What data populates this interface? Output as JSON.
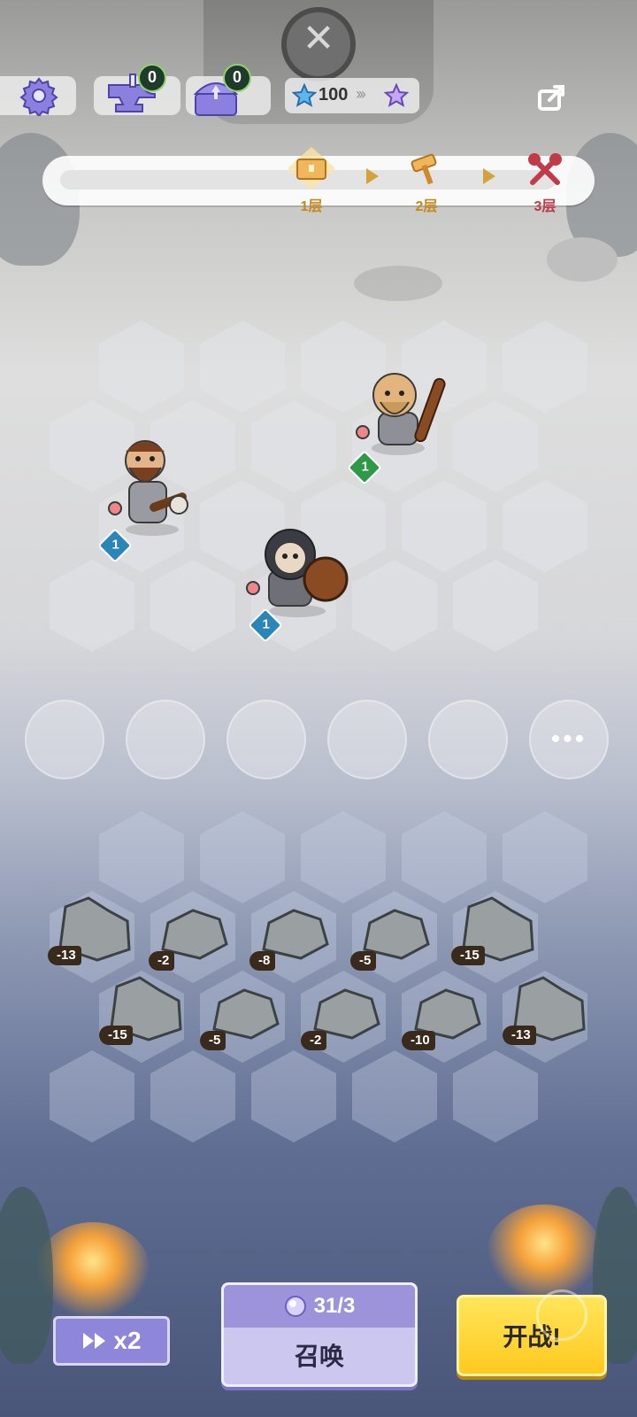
{
  "top_bar": {
    "forge_count": "0",
    "chest_count": "0",
    "stars": "100"
  },
  "progress": {
    "stages": [
      {
        "label": "1层"
      },
      {
        "label": "2层"
      },
      {
        "label": "3层"
      }
    ]
  },
  "units": [
    {
      "level": "1"
    },
    {
      "level": "1"
    },
    {
      "level": "1"
    }
  ],
  "rocks": [
    {
      "value": "-13"
    },
    {
      "value": "-2"
    },
    {
      "value": "-8"
    },
    {
      "value": "-5"
    },
    {
      "value": "-15"
    },
    {
      "value": "-15"
    },
    {
      "value": "-5"
    },
    {
      "value": "-2"
    },
    {
      "value": "-10"
    },
    {
      "value": "-13"
    }
  ],
  "bottom": {
    "speed_label": "x2",
    "summon_cost": "31/3",
    "summon_label": "召唤",
    "fight_label": "开战!"
  },
  "colors": {
    "summon_panel": "#cbc7ef",
    "fight_button": "#ffc91f",
    "progress_stage": "#c78a1b"
  }
}
